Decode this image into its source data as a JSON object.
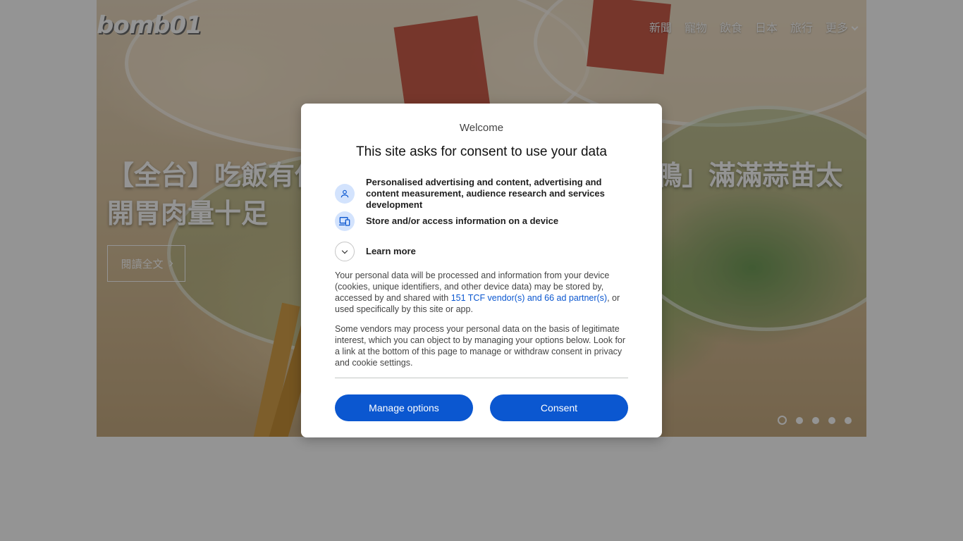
{
  "site": {
    "logo_text": "bomb01",
    "nav": {
      "items": [
        "新聞",
        "寵物",
        "飲食",
        "日本",
        "旅行",
        "更多"
      ]
    }
  },
  "hero": {
    "headline": "【全台】吃飯有保障!必吃泡菜神級推薦「蒜苗鴨」滿滿蒜苗太開胃肉量十足",
    "read_more_label": "閱讀全文",
    "slides": {
      "count": 5,
      "active_index": 1
    }
  },
  "consent_dialog": {
    "welcome": "Welcome",
    "title": "This site asks for consent to use your data",
    "purposes": [
      {
        "icon": "person-icon",
        "text": "Personalised advertising and content, advertising and content measurement, audience research and services development"
      },
      {
        "icon": "devices-icon",
        "text": "Store and/or access information on a device"
      }
    ],
    "learn_more_label": "Learn more",
    "paragraph1_before_link": "Your personal data will be processed and information from your device (cookies, unique identifiers, and other device data) may be stored by, accessed by and shared with ",
    "paragraph1_link": "151 TCF vendor(s) and 66 ad partner(s)",
    "paragraph1_after_link": ", or used specifically by this site or app.",
    "paragraph2": "Some vendors may process your personal data on the basis of legitimate interest, which you can object to by managing your options below. Look for a link at the bottom of this page to manage or withdraw consent in privacy and cookie settings.",
    "manage_button": "Manage options",
    "consent_button": "Consent"
  },
  "colors": {
    "accent": "#0b57d0",
    "icon_bg": "#d3e3fd",
    "overlay": "rgba(0,0,0,0.42)"
  }
}
